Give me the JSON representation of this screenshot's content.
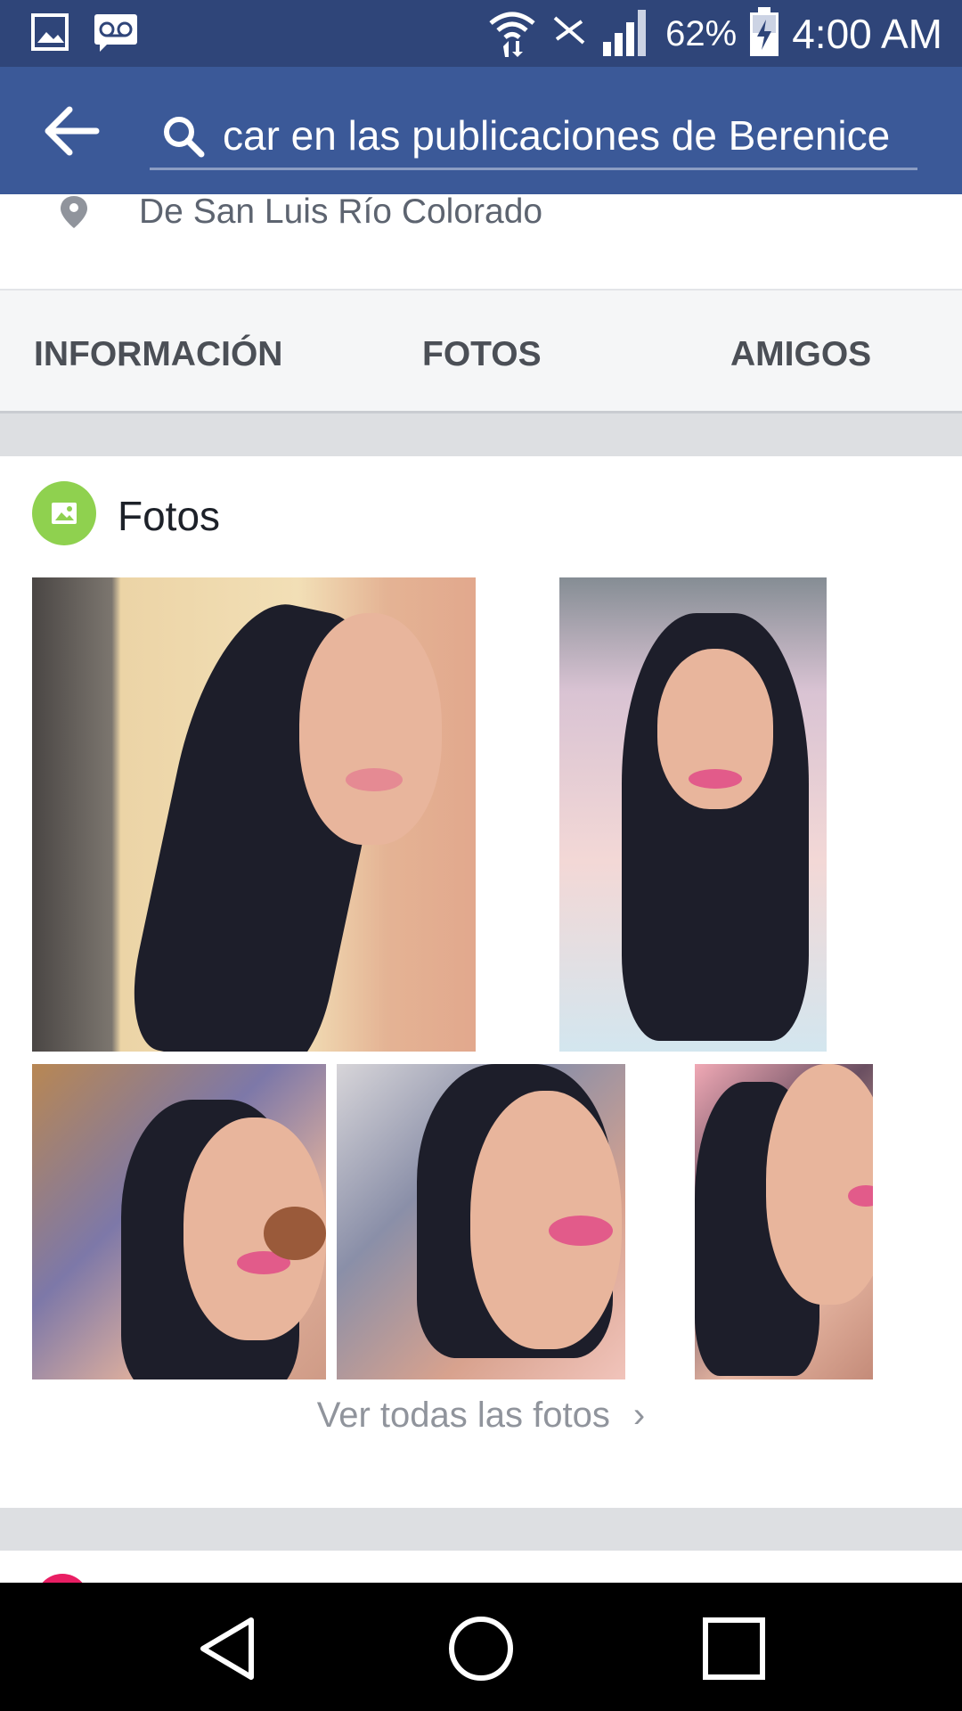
{
  "status_bar": {
    "battery": "62%",
    "time": "4:00 AM",
    "icons": [
      "gallery-icon",
      "voicemail-icon",
      "wifi-icon",
      "no-signal-icon",
      "signal-icon",
      "battery-icon"
    ]
  },
  "header": {
    "back_icon": "back-arrow-icon",
    "search_icon": "search-icon",
    "search_text": "car en las publicaciones de Berenice"
  },
  "profile": {
    "location_icon": "location-pin-icon",
    "location": "De San Luis Río Colorado"
  },
  "tabs": [
    {
      "label": "INFORMACIÓN"
    },
    {
      "label": "FOTOS"
    },
    {
      "label": "AMIGOS"
    }
  ],
  "photos_section": {
    "title": "Fotos",
    "icon": "photo-icon",
    "photo_count": 5,
    "see_all": "Ver todas las fotos"
  },
  "nav_bar": {
    "icons": [
      "back-nav-icon",
      "home-nav-icon",
      "recents-nav-icon"
    ]
  },
  "colors": {
    "status_bar": "#2f4579",
    "app_bar": "#3b5998",
    "photos_icon_bg": "#8fd14f",
    "divider": "#dddfe2"
  }
}
